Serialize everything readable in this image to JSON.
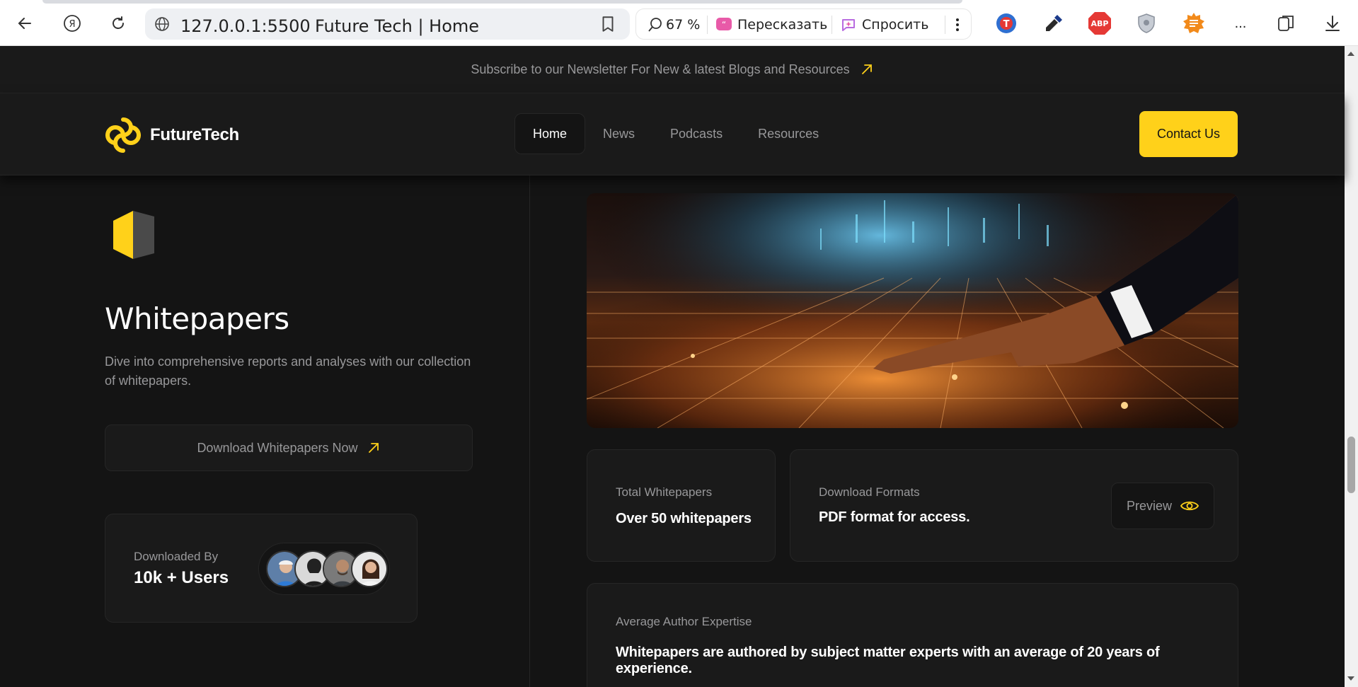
{
  "browser": {
    "url": "127.0.0.1:5500",
    "page_title": "Future Tech | Home",
    "zoom": "67 %",
    "retell_label": "Пересказать",
    "ask_label": "Спросить",
    "more_label": "...",
    "extension_abp": "ABP"
  },
  "newsletter": {
    "text": "Subscribe to our Newsletter For New & latest Blogs and Resources"
  },
  "header": {
    "brand": "FutureTech",
    "nav": [
      {
        "label": "Home"
      },
      {
        "label": "News"
      },
      {
        "label": "Podcasts"
      },
      {
        "label": "Resources"
      }
    ],
    "contact_label": "Contact Us"
  },
  "whitepapers": {
    "title": "Whitepapers",
    "description": "Dive into comprehensive reports and analyses with our collection of whitepapers.",
    "download_label": "Download Whitepapers Now",
    "downloaded_by_label": "Downloaded By",
    "downloaded_by_value": "10k + Users"
  },
  "stats": {
    "total_label": "Total Whitepapers",
    "total_value": "Over 50 whitepapers",
    "formats_label": "Download Formats",
    "formats_value": "PDF format for access.",
    "preview_label": "Preview",
    "expertise_label": "Average Author Expertise",
    "expertise_value": "Whitepapers are authored by subject matter experts with an average of 20 years of experience."
  },
  "colors": {
    "accent": "#ffd11a",
    "background": "#141414",
    "surface": "#1a1a1a",
    "border": "#262626",
    "muted_text": "#98989a"
  },
  "icons": [
    "back-arrow-icon",
    "yandex-icon",
    "reload-icon",
    "globe-icon",
    "bookmark-icon",
    "search-zoom-icon",
    "retell-icon",
    "ask-icon",
    "kebab-menu-icon",
    "arrow-up-right-icon",
    "eye-icon",
    "download-icon"
  ]
}
